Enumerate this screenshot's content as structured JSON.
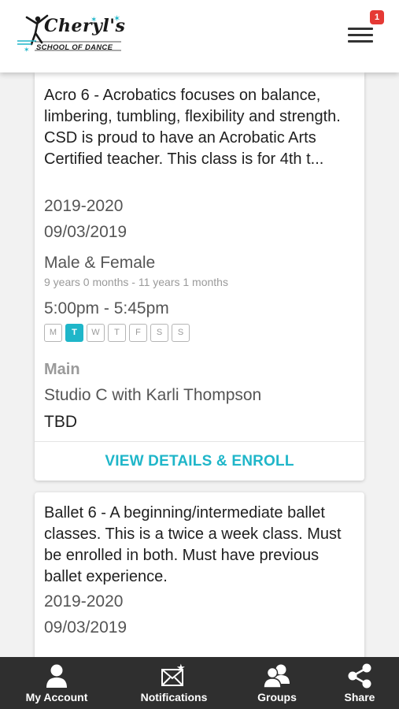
{
  "header": {
    "logo_title": "Cheryl's",
    "logo_subtitle": "SCHOOL OF DANCE",
    "notification_count": "1"
  },
  "classes": [
    {
      "description": "Acro 6 - Acrobatics focuses on balance, limbering, tumbling, flexibility and strength. CSD is proud to have an Acrobatic Arts Certified teacher. This class is for 4th t...",
      "season": "2019-2020",
      "start_date": "09/03/2019",
      "gender": "Male & Female",
      "age_range": "9 years 0 months - 11 years 1 months",
      "time": "5:00pm - 5:45pm",
      "days": [
        {
          "label": "M",
          "active": false
        },
        {
          "label": "T",
          "active": true
        },
        {
          "label": "W",
          "active": false
        },
        {
          "label": "T",
          "active": false
        },
        {
          "label": "F",
          "active": false
        },
        {
          "label": "S",
          "active": false
        },
        {
          "label": "S",
          "active": false
        }
      ],
      "location": "Main",
      "room": "Studio C with Karli Thompson",
      "instructor": "TBD",
      "action_label": "VIEW DETAILS & ENROLL"
    },
    {
      "description": "Ballet 6 - A beginning/intermediate ballet classes. This is a twice a week class. Must be enrolled in both. Must have previous ballet experience.",
      "season": "2019-2020",
      "start_date": "09/03/2019"
    }
  ],
  "bottom_nav": [
    {
      "label": "My Account",
      "icon": "user-icon"
    },
    {
      "label": "Notifications",
      "icon": "envelope-star-icon"
    },
    {
      "label": "Groups",
      "icon": "users-icon"
    },
    {
      "label": "Share",
      "icon": "share-icon"
    }
  ],
  "colors": {
    "accent": "#1fb6c9",
    "badge": "#e53935",
    "nav_bg": "#2f2f2f"
  }
}
